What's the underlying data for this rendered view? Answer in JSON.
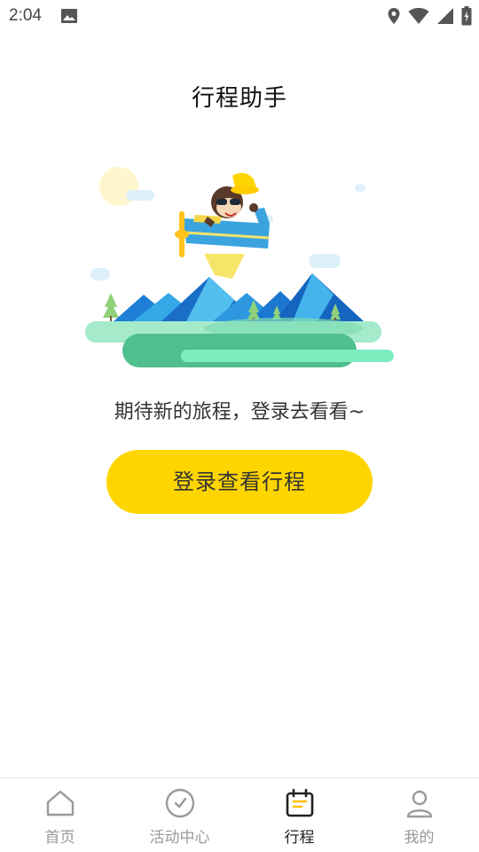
{
  "status_bar": {
    "time": "2:04",
    "icons": [
      "image-icon",
      "location-icon",
      "wifi-icon",
      "cellular-icon",
      "battery-charging-icon"
    ]
  },
  "page": {
    "title": "行程助手",
    "empty_message": "期待新的旅程，登录去看看~",
    "login_button": "登录查看行程",
    "accent_color": "#FFD500"
  },
  "bottom_nav": {
    "items": [
      {
        "label": "首页",
        "icon": "home-icon",
        "active": false
      },
      {
        "label": "活动中心",
        "icon": "clock-icon",
        "active": false
      },
      {
        "label": "行程",
        "icon": "calendar-icon",
        "active": true
      },
      {
        "label": "我的",
        "icon": "profile-icon",
        "active": false
      }
    ]
  }
}
